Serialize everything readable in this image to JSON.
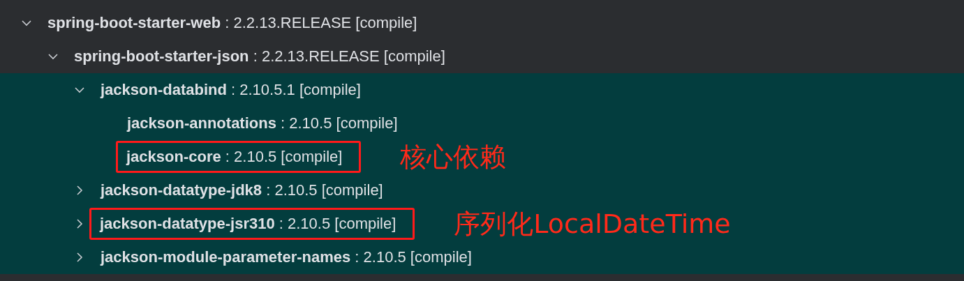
{
  "tree": [
    {
      "label": "**spring-boot-starter-web** : 2.2.13.RELEASE [compile]",
      "expanded": true,
      "selected": false,
      "children": [
        {
          "label": "**spring-boot-starter-json** : 2.2.13.RELEASE [compile]",
          "expanded": true,
          "selected": false,
          "children": [
            {
              "label": "**jackson-databind** : 2.10.5.1 [compile]",
              "expanded": true,
              "selected": true,
              "children": [
                {
                  "label": "**jackson-annotations** : 2.10.5 [compile]",
                  "selected": true
                },
                {
                  "label": "**jackson-core** : 2.10.5 [compile]",
                  "selected": true,
                  "boxed": true,
                  "note": "核心依赖"
                }
              ]
            },
            {
              "label": "**jackson-datatype-jdk8** : 2.10.5 [compile]",
              "expanded": false,
              "selected": true
            },
            {
              "label": "**jackson-datatype-jsr310** : 2.10.5 [compile]",
              "expanded": false,
              "selected": true,
              "boxed": true,
              "note": "序列化LocalDateTime"
            },
            {
              "label": "**jackson-module-parameter-names** : 2.10.5 [compile]",
              "expanded": false,
              "selected": true
            }
          ]
        }
      ]
    }
  ]
}
